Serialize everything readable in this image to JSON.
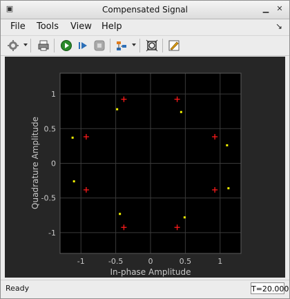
{
  "window": {
    "title": "Compensated Signal"
  },
  "menu": {
    "file": "File",
    "tools": "Tools",
    "view": "View",
    "help": "Help"
  },
  "toolbar": {
    "icons": [
      "settings-icon",
      "print-icon",
      "run-icon",
      "step-forward-icon",
      "stop-icon",
      "highlight-icon",
      "zoom-fit-icon",
      "edit-icon"
    ]
  },
  "status": {
    "text": "Ready",
    "time": "T=20.000"
  },
  "colors": {
    "background": "#000000",
    "reference": "#ff1a1a",
    "received": "#f5f500",
    "axis": "#d0d0d0"
  },
  "chart_data": {
    "type": "scatter",
    "xlabel": "In-phase Amplitude",
    "ylabel": "Quadrature Amplitude",
    "xlim": [
      -1.3,
      1.3
    ],
    "ylim": [
      -1.3,
      1.3
    ],
    "xticks": [
      "-1",
      "-0.5",
      "0",
      "0.5",
      "1"
    ],
    "yticks": [
      "1",
      "0.5",
      "0",
      "-0.5",
      "-1"
    ],
    "xtick_values": [
      -1,
      -0.5,
      0,
      0.5,
      1
    ],
    "ytick_values": [
      1,
      0.5,
      0,
      -0.5,
      -1
    ],
    "grid": true,
    "series": [
      {
        "marker": "plus",
        "color": "#ff1a1a",
        "x": [
          -0.383,
          0.383,
          0.924,
          0.924,
          0.383,
          -0.383,
          -0.924,
          -0.924
        ],
        "y": [
          0.924,
          0.924,
          0.383,
          -0.383,
          -0.924,
          -0.924,
          -0.383,
          0.383
        ]
      },
      {
        "marker": "square",
        "color": "#f5f500",
        "x": [
          -0.48,
          0.44,
          1.1,
          1.12,
          0.49,
          -0.44,
          -1.1,
          -1.12
        ],
        "y": [
          0.78,
          0.74,
          0.26,
          -0.36,
          -0.78,
          -0.73,
          -0.26,
          0.37
        ]
      }
    ]
  }
}
